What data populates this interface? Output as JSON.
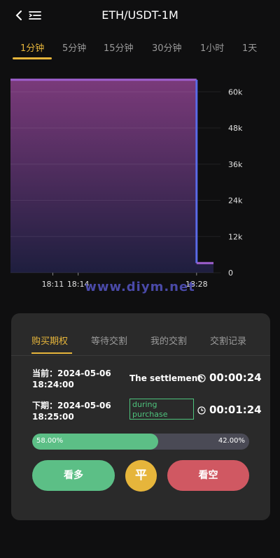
{
  "header": {
    "title": "ETH/USDT-1M",
    "back_icon": "chevron-left-icon",
    "menu_icon": "menu-list-icon"
  },
  "tabs": [
    "1分钟",
    "5分钟",
    "15分钟",
    "30分钟",
    "1小时",
    "1天"
  ],
  "active_tab": 0,
  "chart_data": {
    "type": "area",
    "x": [
      "18:11",
      "18:14",
      "18:28"
    ],
    "xticks": [
      "18:11",
      "18:14",
      "18:28"
    ],
    "yticks": [
      "60k",
      "48k",
      "36k",
      "24k",
      "12k",
      "0"
    ],
    "ylim": [
      0,
      64000
    ],
    "series": [
      {
        "points": [
          {
            "x": "18:06",
            "y": 64000
          },
          {
            "x": "18:28",
            "y": 64000
          },
          {
            "x": "18:28",
            "y": 3200
          },
          {
            "x": "18:30",
            "y": 3200
          }
        ]
      }
    ],
    "grid": true,
    "colors": {
      "line": "#a060d0",
      "fill_top": "#7a3a7a",
      "fill_bottom": "#1e1e3e",
      "drop_line": "#5a6ae8"
    }
  },
  "watermark": "www.diym.net",
  "panel": {
    "tabs": [
      "购买期权",
      "等待交割",
      "我的交割",
      "交割记录"
    ],
    "active_tab": 0,
    "current": {
      "label": "当前：2024-05-06 18:24:00",
      "status": "The settlement",
      "timer": "00:00:24"
    },
    "next": {
      "label": "下期：2024-05-06 18:25:00",
      "status": "during purchase",
      "timer": "00:01:24"
    },
    "ratio": {
      "long_pct": 58.0,
      "long_label": "58.00%",
      "short_label": "42.00%"
    },
    "buttons": {
      "long": "看多",
      "flat": "平",
      "short": "看空"
    },
    "colors": {
      "long": "#5cbf86",
      "short": "#d05862",
      "accent": "#e6b53b"
    }
  }
}
